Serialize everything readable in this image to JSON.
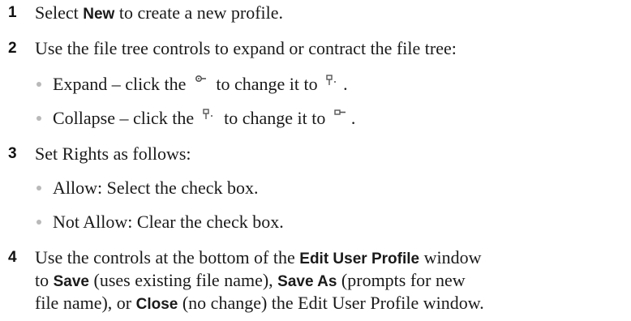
{
  "steps": [
    {
      "number": "1",
      "pre": "Select ",
      "kw": "New",
      "post": " to create a new profile."
    },
    {
      "number": "2",
      "text": "Use the file tree controls to expand or contract the file tree:",
      "bullets": [
        {
          "pre": "Expand – click the ",
          "mid": " to change it to ",
          "post": "."
        },
        {
          "pre": "Collapse – click the ",
          "mid": " to change it to ",
          "post": "."
        }
      ]
    },
    {
      "number": "3",
      "text": "Set Rights as follows:",
      "bullets": [
        {
          "text": "Allow: Select the check box."
        },
        {
          "text": "Not Allow: Clear the check box."
        }
      ]
    },
    {
      "number": "4",
      "l1_pre": "Use the controls at the bottom of the ",
      "l1_kw": "Edit User Profile",
      "l1_post": " window",
      "l2_pre": "to ",
      "l2_kw1": "Save",
      "l2_mid": " (uses existing file name), ",
      "l2_kw2": "Save As",
      "l2_post": " (prompts for new",
      "l3_pre": "file name), or ",
      "l3_kw": "Close",
      "l3_post": " (no change) the Edit User Profile window."
    }
  ],
  "icons": {
    "collapsed_node": "tree-collapsed-icon",
    "expanded_node": "tree-expanded-icon"
  },
  "colors": {
    "text": "#1a1a1a",
    "bullet": "#b9b9b9",
    "icon": "#555555"
  }
}
